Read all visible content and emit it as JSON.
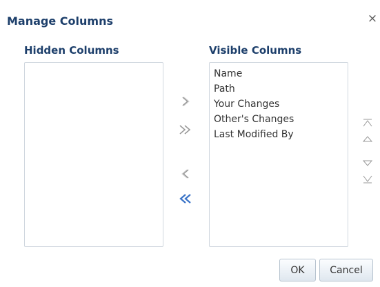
{
  "dialog": {
    "title": "Manage Columns",
    "close_icon": "close-icon"
  },
  "hidden_columns": {
    "header": "Hidden Columns",
    "items": []
  },
  "visible_columns": {
    "header": "Visible Columns",
    "items": [
      {
        "label": "Name"
      },
      {
        "label": "Path"
      },
      {
        "label": "Your Changes"
      },
      {
        "label": "Other's Changes"
      },
      {
        "label": "Last Modified By"
      }
    ]
  },
  "shuttle_icons": [
    "move-selected-right-icon",
    "move-all-right-icon",
    "move-selected-left-icon",
    "move-all-left-icon"
  ],
  "reorder_icons": [
    "move-to-top-icon",
    "move-up-icon",
    "move-down-icon",
    "move-to-bottom-icon"
  ],
  "buttons": {
    "ok_label": "OK",
    "cancel_label": "Cancel"
  },
  "colors": {
    "title": "#1d3f6b",
    "active_arrow": "#3a73c7",
    "inactive_arrow": "#9a9a9a",
    "list_border": "#cfd6de"
  }
}
